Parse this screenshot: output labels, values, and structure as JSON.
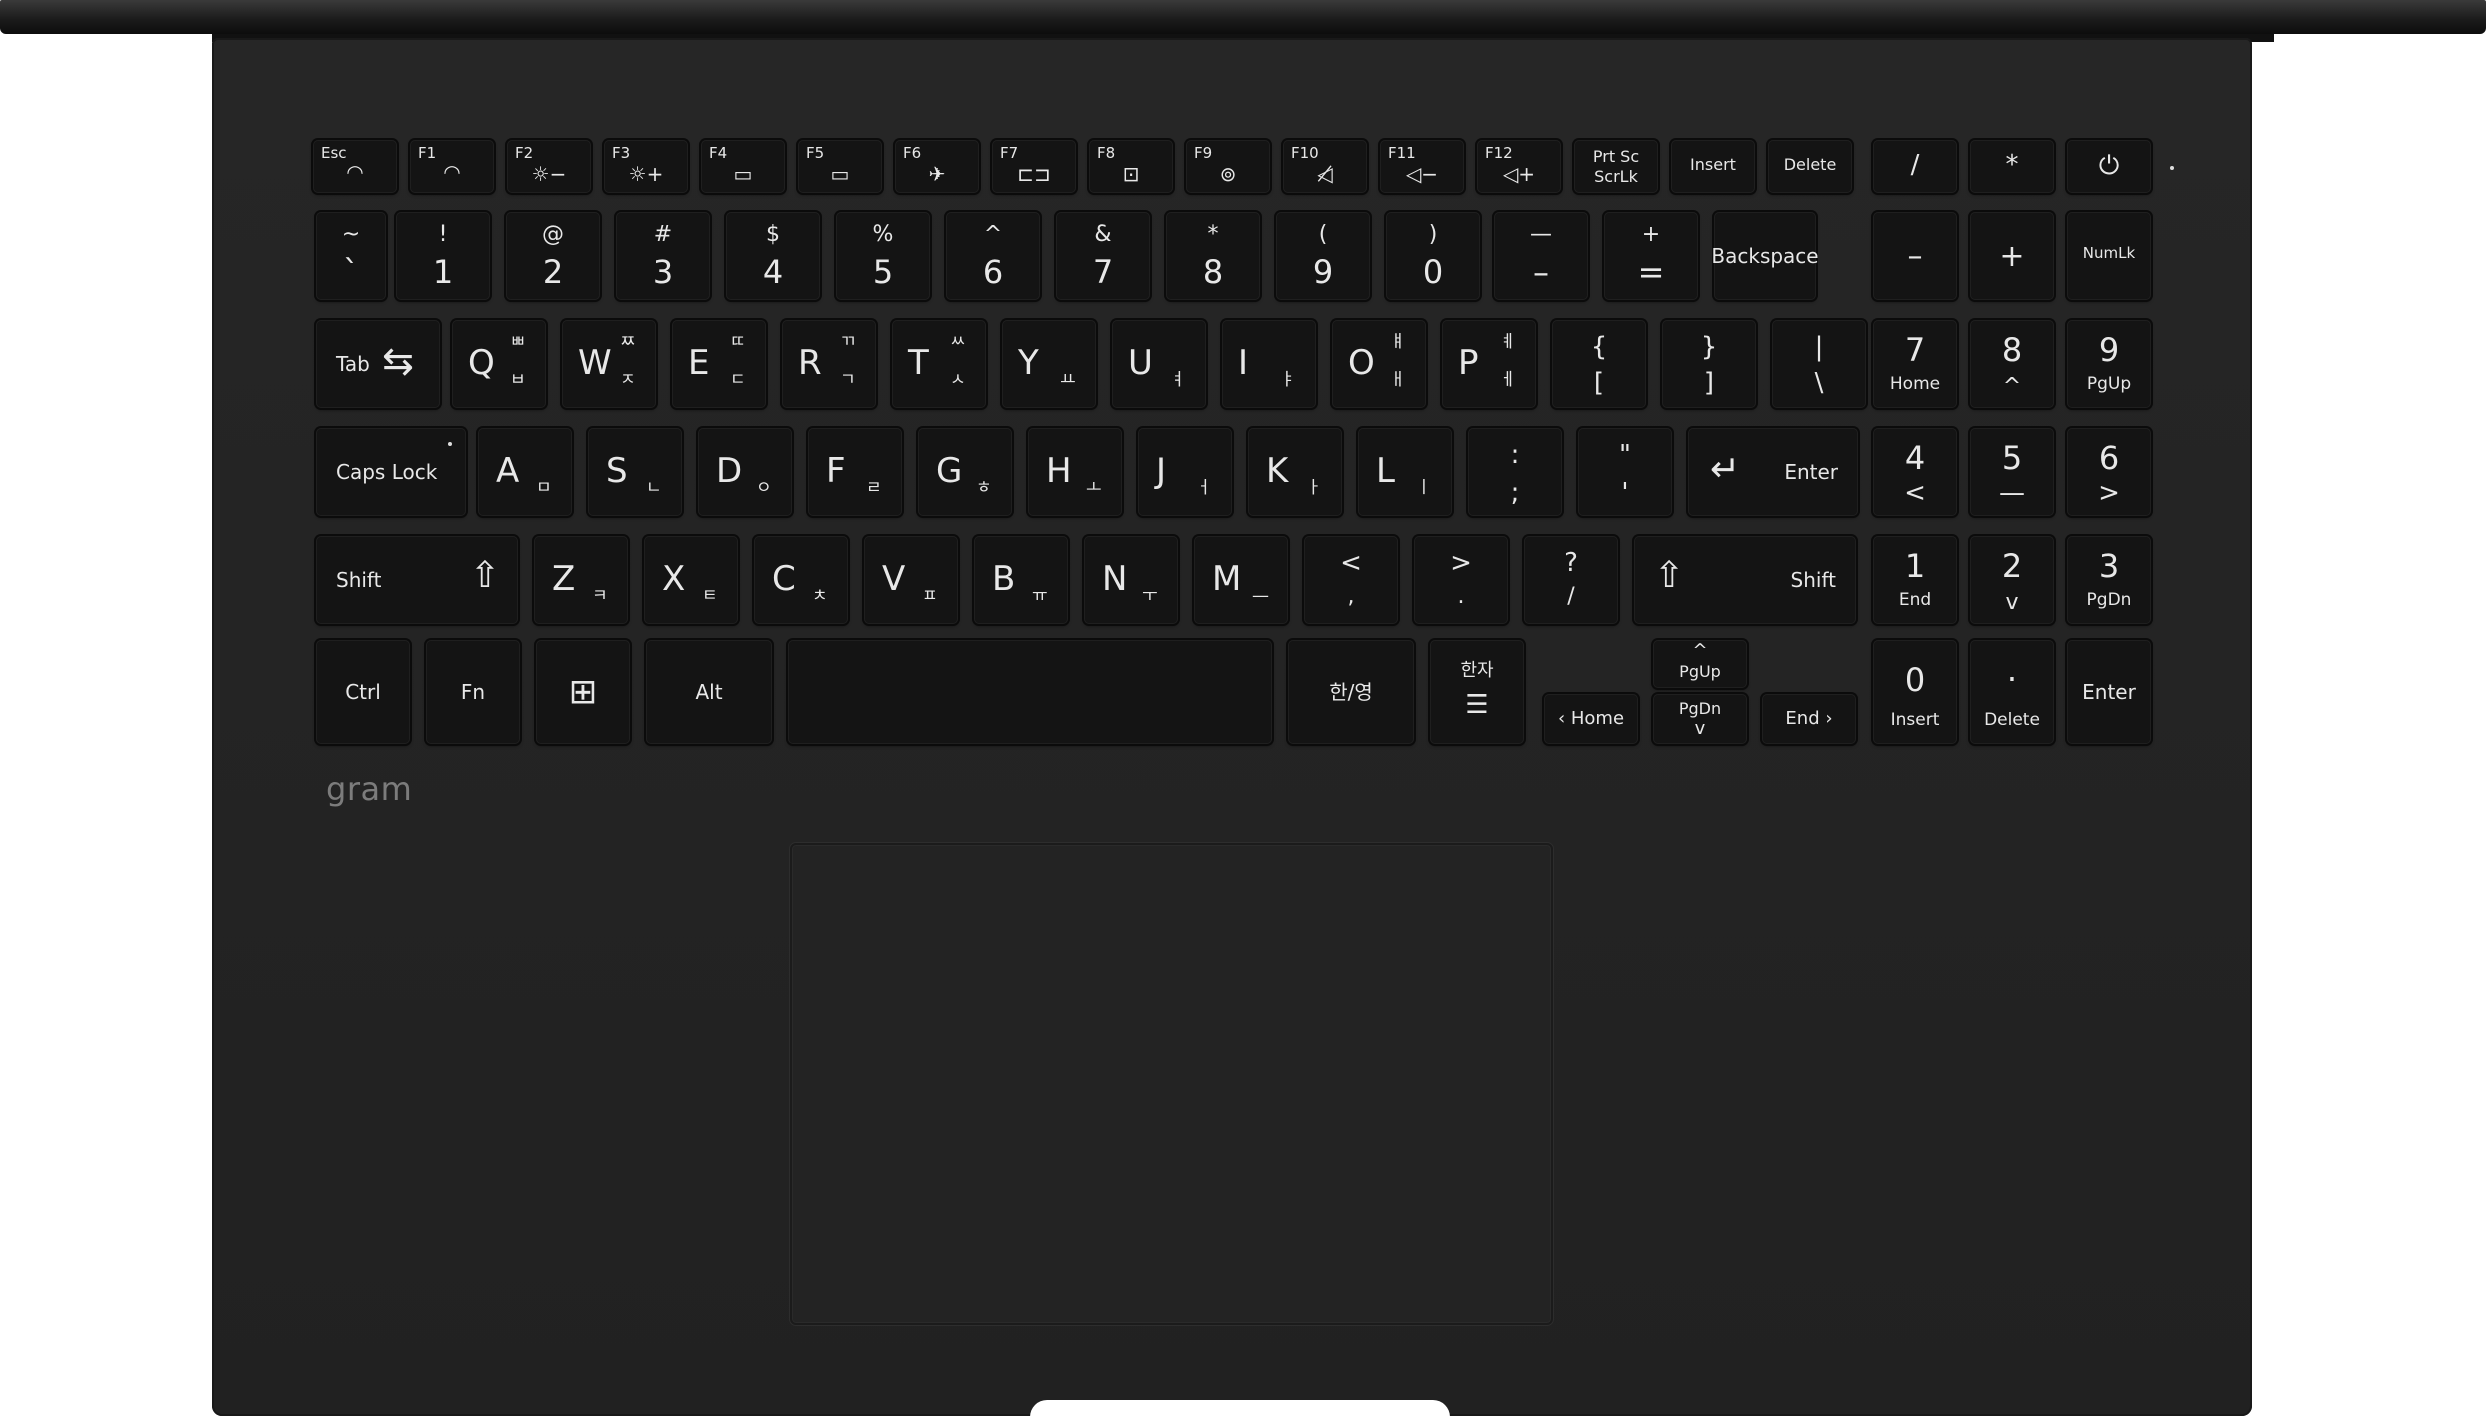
{
  "brand": {
    "logo_text": "gram"
  },
  "fn_row": [
    {
      "label": "Esc",
      "icon": "headset-icon"
    },
    {
      "label": "F1",
      "icon": "sliders-icon"
    },
    {
      "label": "F2",
      "icon": "brightness-down-icon",
      "glyph": "☼−"
    },
    {
      "label": "F3",
      "icon": "brightness-up-icon",
      "glyph": "☼+"
    },
    {
      "label": "F4",
      "icon": "display-switch-icon",
      "glyph": "▭"
    },
    {
      "label": "F5",
      "icon": "touchpad-icon",
      "glyph": "▭"
    },
    {
      "label": "F6",
      "icon": "airplane-icon",
      "glyph": "✈"
    },
    {
      "label": "F7",
      "icon": "reader-mode-icon",
      "glyph": "⊏⊐"
    },
    {
      "label": "F8",
      "icon": "keyboard-backlight-icon",
      "glyph": "⊡"
    },
    {
      "label": "F9",
      "icon": "lg-control-center-icon",
      "glyph": "⊚"
    },
    {
      "label": "F10",
      "icon": "mute-icon",
      "glyph": "◁̸"
    },
    {
      "label": "F11",
      "icon": "volume-down-icon",
      "glyph": "◁−"
    },
    {
      "label": "F12",
      "icon": "volume-up-icon",
      "glyph": "◁+"
    },
    {
      "label": "Prt Sc",
      "label2": "ScrLk"
    },
    {
      "label": "Insert"
    },
    {
      "label": "Delete"
    },
    {
      "label": "/"
    },
    {
      "label": "*"
    },
    {
      "label": "",
      "icon": "power-icon",
      "glyph": "⏻"
    }
  ],
  "number_row": [
    {
      "top": "~",
      "bottom": "`"
    },
    {
      "top": "!",
      "bottom": "1"
    },
    {
      "top": "@",
      "bottom": "2"
    },
    {
      "top": "#",
      "bottom": "3"
    },
    {
      "top": "$",
      "bottom": "4"
    },
    {
      "top": "%",
      "bottom": "5"
    },
    {
      "top": "^",
      "bottom": "6"
    },
    {
      "top": "&",
      "bottom": "7"
    },
    {
      "top": "*",
      "bottom": "8"
    },
    {
      "top": "(",
      "bottom": "9"
    },
    {
      "top": ")",
      "bottom": "0"
    },
    {
      "top": "—",
      "bottom": "–"
    },
    {
      "top": "+",
      "bottom": "="
    },
    {
      "main": "Backspace"
    },
    {
      "main": "–"
    },
    {
      "main": "+"
    },
    {
      "main": "NumLk"
    }
  ],
  "top_row": [
    {
      "main": "Tab",
      "glyph": "⇆"
    },
    {
      "main": "Q",
      "kor_top": "ㅃ",
      "kor_bottom": "ㅂ"
    },
    {
      "main": "W",
      "kor_top": "ㅉ",
      "kor_bottom": "ㅈ"
    },
    {
      "main": "E",
      "kor_top": "ㄸ",
      "kor_bottom": "ㄷ"
    },
    {
      "main": "R",
      "kor_top": "ㄲ",
      "kor_bottom": "ㄱ"
    },
    {
      "main": "T",
      "kor_top": "ㅆ",
      "kor_bottom": "ㅅ"
    },
    {
      "main": "Y",
      "kor_bottom": "ㅛ"
    },
    {
      "main": "U",
      "kor_bottom": "ㅕ"
    },
    {
      "main": "I",
      "kor_bottom": "ㅑ"
    },
    {
      "main": "O",
      "kor_top": "ㅒ",
      "kor_bottom": "ㅐ"
    },
    {
      "main": "P",
      "kor_top": "ㅖ",
      "kor_bottom": "ㅔ"
    },
    {
      "top": "{",
      "bottom": "["
    },
    {
      "top": "}",
      "bottom": "]"
    },
    {
      "top": "|",
      "bottom": "\\"
    },
    {
      "top": "7",
      "bottom": "Home"
    },
    {
      "top": "8",
      "bottom": "^"
    },
    {
      "top": "9",
      "bottom": "PgUp"
    }
  ],
  "home_row": [
    {
      "main": "Caps Lock"
    },
    {
      "main": "A",
      "kor_bottom": "ㅁ"
    },
    {
      "main": "S",
      "kor_bottom": "ㄴ"
    },
    {
      "main": "D",
      "kor_bottom": "ㅇ"
    },
    {
      "main": "F",
      "kor_bottom": "ㄹ"
    },
    {
      "main": "G",
      "kor_bottom": "ㅎ"
    },
    {
      "main": "H",
      "kor_bottom": "ㅗ"
    },
    {
      "main": "J",
      "kor_bottom": "ㅓ"
    },
    {
      "main": "K",
      "kor_bottom": "ㅏ"
    },
    {
      "main": "L",
      "kor_bottom": "ㅣ"
    },
    {
      "top": ":",
      "bottom": ";"
    },
    {
      "top": "\"",
      "bottom": "'"
    },
    {
      "main": "Enter",
      "glyph": "↵"
    },
    {
      "top": "4",
      "bottom": "<"
    },
    {
      "top": "5",
      "bottom": "—"
    },
    {
      "top": "6",
      "bottom": ">"
    }
  ],
  "shift_row": [
    {
      "main": "Shift",
      "glyph": "⇧"
    },
    {
      "main": "Z",
      "kor_bottom": "ㅋ"
    },
    {
      "main": "X",
      "kor_bottom": "ㅌ"
    },
    {
      "main": "C",
      "kor_bottom": "ㅊ"
    },
    {
      "main": "V",
      "kor_bottom": "ㅍ"
    },
    {
      "main": "B",
      "kor_bottom": "ㅠ"
    },
    {
      "main": "N",
      "kor_bottom": "ㅜ"
    },
    {
      "main": "M",
      "kor_bottom": "—"
    },
    {
      "top": "<",
      "bottom": ","
    },
    {
      "top": ">",
      "bottom": "."
    },
    {
      "top": "?",
      "bottom": "/"
    },
    {
      "main": "Shift",
      "glyph": "⇧"
    },
    {
      "top": "1",
      "bottom": "End"
    },
    {
      "top": "2",
      "bottom": "v"
    },
    {
      "top": "3",
      "bottom": "PgDn"
    }
  ],
  "bottom_row": {
    "ctrl": "Ctrl",
    "fn": "Fn",
    "alt": "Alt",
    "han_yeong": "한/영",
    "hanja": "한자",
    "home": "Home",
    "pgup": "PgUp",
    "pgdn": "PgDn",
    "end": "End",
    "zero_top": "0",
    "zero_bottom": "Insert",
    "dot_top": ".",
    "dot_bottom": "Delete",
    "num_enter": "Enter"
  },
  "colors": {
    "body": "#232323",
    "key": "#141414",
    "legend": "#e8e8e8",
    "logo": "#7c7c7c"
  }
}
